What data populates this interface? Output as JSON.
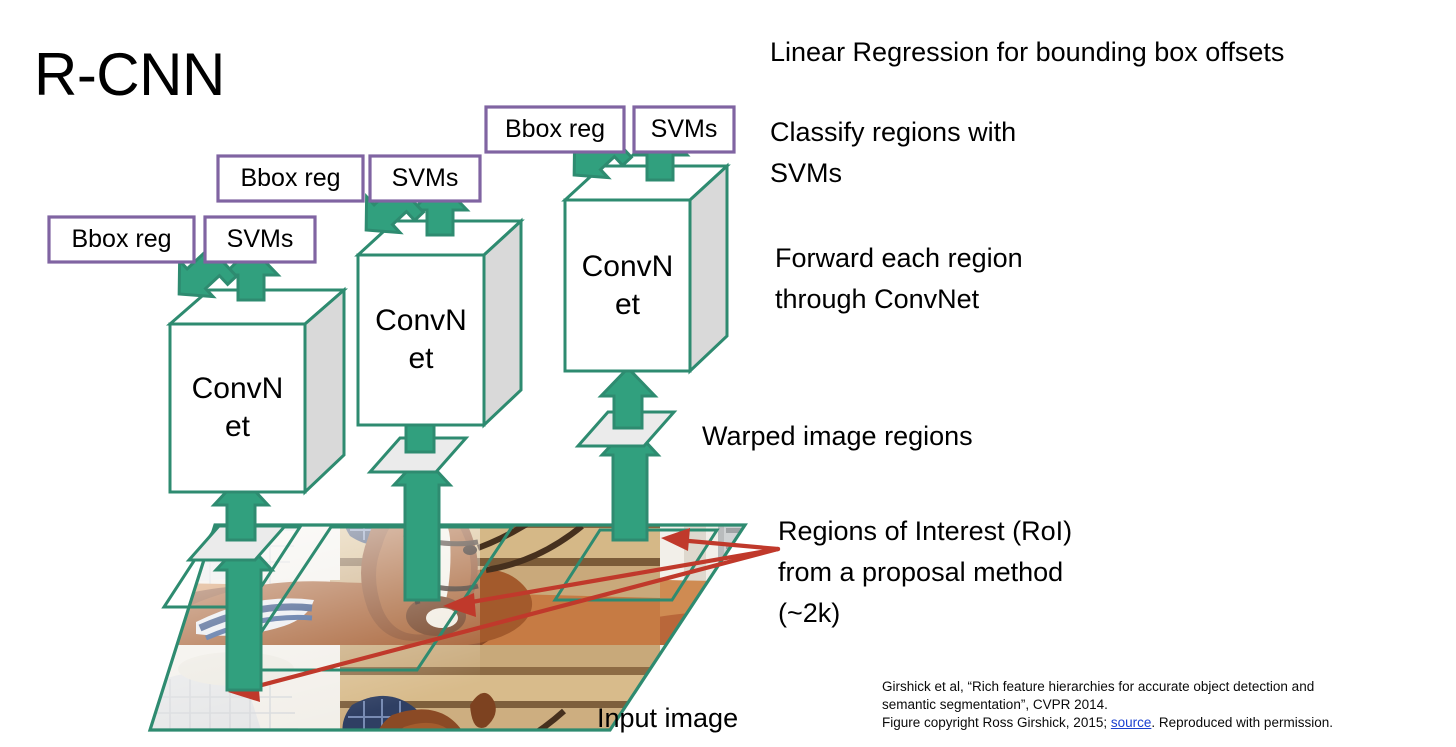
{
  "slide": {
    "title": "R-CNN",
    "background_color": "#ffffff"
  },
  "colors": {
    "teal_outline": "#2e8b70",
    "teal_arrow_fill": "#31a07e",
    "purple_box_border": "#8064a2",
    "red_arrow": "#c0392b",
    "cube_side_gray": "#d9d9d9",
    "warped_region_gray": "#ebebeb",
    "link_blue": "#1a3fd0"
  },
  "annotations": {
    "linear_regression": "Linear Regression for bounding box offsets",
    "classify": "Classify regions with SVMs",
    "forward": "Forward each region through ConvNet",
    "warped": "Warped image regions",
    "roi": "Regions of Interest (RoI) from a proposal method (~2k)",
    "input_image": "Input image"
  },
  "pipelines": [
    {
      "id": "pipeline-1",
      "bbox_reg_label": "Bbox reg",
      "svms_label": "SVMs",
      "convnet_label_line1": "ConvN",
      "convnet_label_line2": "et"
    },
    {
      "id": "pipeline-2",
      "bbox_reg_label": "Bbox reg",
      "svms_label": "SVMs",
      "convnet_label_line1": "ConvN",
      "convnet_label_line2": "et"
    },
    {
      "id": "pipeline-3",
      "bbox_reg_label": "Bbox reg",
      "svms_label": "SVMs",
      "convnet_label_line1": "ConvN",
      "convnet_label_line2": "et"
    }
  ],
  "citation": {
    "line1": "Girshick et al, “Rich feature hierarchies for accurate object detection and",
    "line2": "semantic segmentation”, CVPR 2014.",
    "line3_before": "Figure copyright Ross Girshick, 2015; ",
    "link_text": "source",
    "line3_after": ". Reproduced with permission."
  }
}
